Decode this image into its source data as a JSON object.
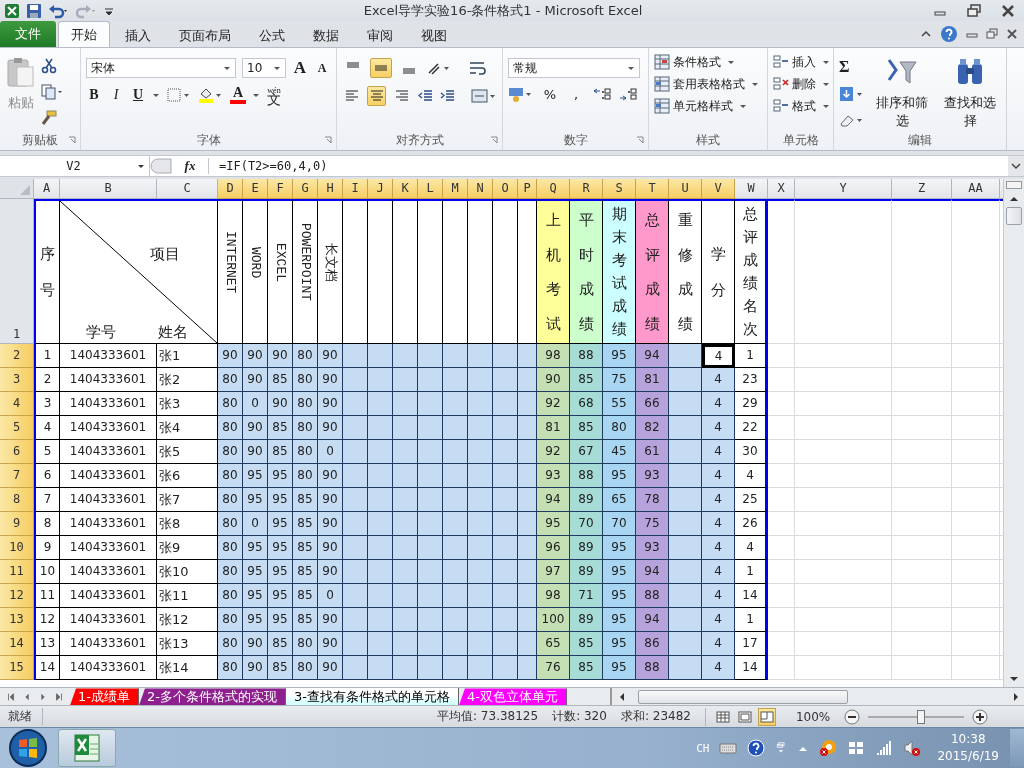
{
  "window": {
    "title": "Excel导学实验16-条件格式1  -  Microsoft Excel"
  },
  "ribbon_tabs": [
    {
      "label": "文件",
      "kind": "file",
      "selected": false
    },
    {
      "label": "开始",
      "kind": "tab",
      "selected": true
    },
    {
      "label": "插入",
      "kind": "tab",
      "selected": false
    },
    {
      "label": "页面布局",
      "kind": "tab",
      "selected": false
    },
    {
      "label": "公式",
      "kind": "tab",
      "selected": false
    },
    {
      "label": "数据",
      "kind": "tab",
      "selected": false
    },
    {
      "label": "审阅",
      "kind": "tab",
      "selected": false
    },
    {
      "label": "视图",
      "kind": "tab",
      "selected": false
    }
  ],
  "clipboard": {
    "paste": "粘贴",
    "group": "剪贴板"
  },
  "font": {
    "name": "宋体",
    "size": "10",
    "grow_key": "A",
    "shrink_key": "A",
    "bold_key": "B",
    "italic_key": "I",
    "underline_key": "U",
    "color_key": "A",
    "pinyin": "wén",
    "phonetic": "文",
    "group": "字体"
  },
  "alignment": {
    "vertical": [
      {
        "selected": false
      },
      {
        "selected": true
      },
      {
        "selected": false
      }
    ],
    "horizontal": [
      {
        "selected": false
      },
      {
        "selected": true
      },
      {
        "selected": false
      }
    ],
    "group": "对齐方式"
  },
  "number": {
    "format": "常规",
    "percent": "%",
    "comma": ",",
    "group": "数字"
  },
  "styles": {
    "items": [
      "条件格式",
      "套用表格格式",
      "单元格样式"
    ],
    "group": "样式"
  },
  "cells": {
    "items": [
      "插入",
      "删除",
      "格式"
    ],
    "group": "单元格"
  },
  "editing": {
    "sum": "Σ",
    "sort": "排序和筛选",
    "find": "查找和选择",
    "group": "编辑"
  },
  "formula_bar": {
    "name_box": "V2",
    "fx": "fx",
    "formula": "=IF(T2>=60,4,0)"
  },
  "columns": [
    {
      "label": "A",
      "selected": false
    },
    {
      "label": "B",
      "selected": false
    },
    {
      "label": "C",
      "selected": false
    },
    {
      "label": "D",
      "selected": true
    },
    {
      "label": "E",
      "selected": true
    },
    {
      "label": "F",
      "selected": true
    },
    {
      "label": "G",
      "selected": true
    },
    {
      "label": "H",
      "selected": true
    },
    {
      "label": "I",
      "selected": true
    },
    {
      "label": "J",
      "selected": true
    },
    {
      "label": "K",
      "selected": true
    },
    {
      "label": "L",
      "selected": true
    },
    {
      "label": "M",
      "selected": true
    },
    {
      "label": "N",
      "selected": true
    },
    {
      "label": "O",
      "selected": true
    },
    {
      "label": "P",
      "selected": true
    },
    {
      "label": "Q",
      "selected": true
    },
    {
      "label": "R",
      "selected": true
    },
    {
      "label": "S",
      "selected": true
    },
    {
      "label": "T",
      "selected": true
    },
    {
      "label": "U",
      "selected": true
    },
    {
      "label": "V",
      "selected": true
    },
    {
      "label": "W",
      "selected": false
    },
    {
      "label": "X",
      "selected": false
    },
    {
      "label": "Y",
      "selected": false
    },
    {
      "label": "Z",
      "selected": false
    },
    {
      "label": "AA",
      "selected": false
    }
  ],
  "header_row": {
    "number": "1",
    "seq": "序号",
    "item": "项目",
    "id": "学号",
    "name": "姓名",
    "subjects": [
      "INTERNET",
      "WORD",
      "EXCEL",
      "POWERPOINT",
      "长文档"
    ],
    "results": [
      {
        "label": "上机考试",
        "color": "#ffff99"
      },
      {
        "label": "平时成绩",
        "color": "#ccffcc"
      },
      {
        "label": "期末考试成绩",
        "color": "#ccffff"
      },
      {
        "label": "总评成绩",
        "color": "#ff99cc"
      },
      {
        "label": "重修成绩",
        "color": "#ffffff"
      },
      {
        "label": "学分",
        "color": "#ffffff"
      },
      {
        "label": "总评成绩名次",
        "color": "#ffffff"
      }
    ]
  },
  "rows": [
    {
      "number": "2",
      "selected": true,
      "seq": "1",
      "id": "1404333601",
      "name": "张1",
      "scores": [
        "90",
        "90",
        "90",
        "80",
        "90"
      ],
      "results": [
        "98",
        "88",
        "95",
        "94"
      ],
      "credit": "4",
      "active": true,
      "rank": "1"
    },
    {
      "number": "3",
      "selected": true,
      "seq": "2",
      "id": "1404333601",
      "name": "张2",
      "scores": [
        "80",
        "90",
        "85",
        "80",
        "90"
      ],
      "results": [
        "90",
        "85",
        "75",
        "81"
      ],
      "credit": "4",
      "active": false,
      "rank": "23"
    },
    {
      "number": "4",
      "selected": true,
      "seq": "3",
      "id": "1404333601",
      "name": "张3",
      "scores": [
        "80",
        "0",
        "90",
        "80",
        "90"
      ],
      "results": [
        "92",
        "68",
        "55",
        "66"
      ],
      "credit": "4",
      "active": false,
      "rank": "29"
    },
    {
      "number": "5",
      "selected": true,
      "seq": "4",
      "id": "1404333601",
      "name": "张4",
      "scores": [
        "80",
        "90",
        "85",
        "80",
        "90"
      ],
      "results": [
        "81",
        "85",
        "80",
        "82"
      ],
      "credit": "4",
      "active": false,
      "rank": "22"
    },
    {
      "number": "6",
      "selected": true,
      "seq": "5",
      "id": "1404333601",
      "name": "张5",
      "scores": [
        "80",
        "90",
        "85",
        "80",
        "0"
      ],
      "results": [
        "92",
        "67",
        "45",
        "61"
      ],
      "credit": "4",
      "active": false,
      "rank": "30"
    },
    {
      "number": "7",
      "selected": true,
      "seq": "6",
      "id": "1404333601",
      "name": "张6",
      "scores": [
        "80",
        "95",
        "95",
        "80",
        "90"
      ],
      "results": [
        "93",
        "88",
        "95",
        "93"
      ],
      "credit": "4",
      "active": false,
      "rank": "4"
    },
    {
      "number": "8",
      "selected": true,
      "seq": "7",
      "id": "1404333601",
      "name": "张7",
      "scores": [
        "80",
        "95",
        "95",
        "85",
        "90"
      ],
      "results": [
        "94",
        "89",
        "65",
        "78"
      ],
      "credit": "4",
      "active": false,
      "rank": "25"
    },
    {
      "number": "9",
      "selected": true,
      "seq": "8",
      "id": "1404333601",
      "name": "张8",
      "scores": [
        "80",
        "0",
        "95",
        "85",
        "90"
      ],
      "results": [
        "95",
        "70",
        "70",
        "75"
      ],
      "credit": "4",
      "active": false,
      "rank": "26"
    },
    {
      "number": "10",
      "selected": true,
      "seq": "9",
      "id": "1404333601",
      "name": "张9",
      "scores": [
        "80",
        "95",
        "95",
        "85",
        "90"
      ],
      "results": [
        "96",
        "89",
        "95",
        "93"
      ],
      "credit": "4",
      "active": false,
      "rank": "4"
    },
    {
      "number": "11",
      "selected": true,
      "seq": "10",
      "id": "1404333601",
      "name": "张10",
      "scores": [
        "80",
        "95",
        "95",
        "85",
        "90"
      ],
      "results": [
        "97",
        "89",
        "95",
        "94"
      ],
      "credit": "4",
      "active": false,
      "rank": "1"
    },
    {
      "number": "12",
      "selected": true,
      "seq": "11",
      "id": "1404333601",
      "name": "张11",
      "scores": [
        "80",
        "95",
        "95",
        "85",
        "0"
      ],
      "results": [
        "98",
        "71",
        "95",
        "88"
      ],
      "credit": "4",
      "active": false,
      "rank": "14"
    },
    {
      "number": "13",
      "selected": true,
      "seq": "12",
      "id": "1404333601",
      "name": "张12",
      "scores": [
        "80",
        "95",
        "95",
        "85",
        "90"
      ],
      "results": [
        "100",
        "89",
        "95",
        "94"
      ],
      "credit": "4",
      "active": false,
      "rank": "1"
    },
    {
      "number": "14",
      "selected": true,
      "seq": "13",
      "id": "1404333601",
      "name": "张13",
      "scores": [
        "80",
        "90",
        "85",
        "80",
        "90"
      ],
      "results": [
        "65",
        "85",
        "95",
        "86"
      ],
      "credit": "4",
      "active": false,
      "rank": "17"
    },
    {
      "number": "15",
      "selected": true,
      "seq": "14",
      "id": "1404333601",
      "name": "张14",
      "scores": [
        "80",
        "90",
        "85",
        "80",
        "90"
      ],
      "results": [
        "76",
        "85",
        "95",
        "88"
      ],
      "credit": "4",
      "active": false,
      "rank": "14"
    }
  ],
  "sheet_tabs": [
    {
      "label": "1-成绩单",
      "color": "#ff0000",
      "selected": false
    },
    {
      "label": "2-多个条件格式的实现",
      "color": "#8e1f8e",
      "selected": false
    },
    {
      "label": "3-查找有条件格式的单元格",
      "color": "#ccffff",
      "selected": true
    },
    {
      "label": "4-双色立体单元",
      "color": "#ff00ff",
      "selected": false
    }
  ],
  "status_bar": {
    "ready": "就绪",
    "average": "平均值: 73.38125",
    "count": "计数: 320",
    "sum": "求和: 23482",
    "views": [
      {
        "selected": false
      },
      {
        "selected": false
      },
      {
        "selected": true
      }
    ],
    "zoom": "100%",
    "zoom_slider": {
      "level": 0.55
    }
  },
  "taskbar": {
    "language": "CH",
    "time": "10:38",
    "date": "2015/6/19"
  }
}
